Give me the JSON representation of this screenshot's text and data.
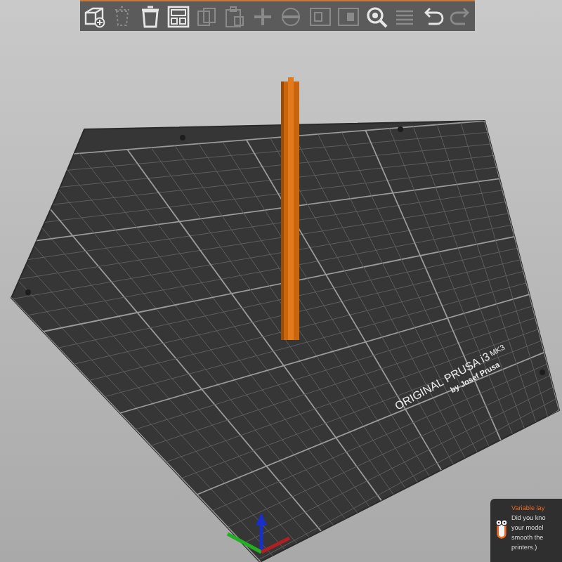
{
  "toolbar": [
    {
      "kind": "add",
      "disabled": false
    },
    {
      "kind": "delete",
      "disabled": true
    },
    {
      "kind": "delete_all",
      "disabled": false
    },
    {
      "kind": "arrange",
      "disabled": false
    },
    {
      "kind": "copy",
      "disabled": true
    },
    {
      "kind": "paste",
      "disabled": true
    },
    {
      "kind": "add_instance",
      "disabled": true
    },
    {
      "kind": "remove_instance",
      "disabled": true
    },
    {
      "kind": "split_objects",
      "disabled": true
    },
    {
      "kind": "split_parts",
      "disabled": true
    },
    {
      "kind": "search",
      "disabled": false
    },
    {
      "kind": "layers",
      "disabled": true
    },
    {
      "kind": "undo",
      "disabled": false
    },
    {
      "kind": "redo",
      "disabled": true
    }
  ],
  "bed": {
    "labels": [
      "ORIGINAL PRUSA i3",
      "MK3",
      "by Josef Prusa"
    ]
  },
  "hint": {
    "title": "Variable lay",
    "lines": [
      "Did you kno",
      "your model",
      "smooth the",
      "printers.)"
    ]
  }
}
